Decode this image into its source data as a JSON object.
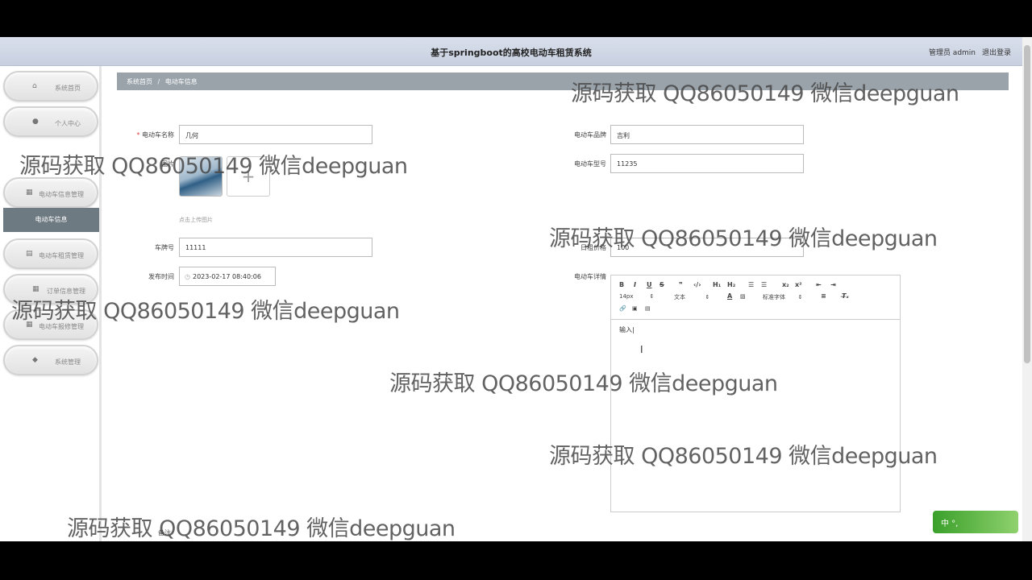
{
  "header": {
    "title": "基于springboot的高校电动车租赁系统",
    "user": "管理员 admin",
    "logout": "退出登录"
  },
  "sidebar": {
    "items": [
      {
        "label": "系统首页",
        "icon": "home-icon"
      },
      {
        "label": "个人中心",
        "icon": "user-icon"
      },
      {
        "label": "电动车信息管理",
        "icon": "grid-icon"
      },
      {
        "label": "电动车信息",
        "active": true
      },
      {
        "label": "电动车租赁管理",
        "icon": "doc-icon"
      },
      {
        "label": "订单信息管理",
        "icon": "grid-icon"
      },
      {
        "label": "电动车报修管理",
        "icon": "grid-icon"
      },
      {
        "label": "系统管理",
        "icon": "pin-icon"
      }
    ]
  },
  "breadcrumb": {
    "home": "系统首页",
    "sep": "/",
    "current": "电动车信息"
  },
  "form": {
    "name_label": "电动车名称",
    "name_value": "几何",
    "image_label": "图片",
    "upload_hint": "点击上传图片",
    "plate_label": "车牌号",
    "plate_value": "11111",
    "time_label": "发布时间",
    "time_value": "2023-02-17 08:40:06",
    "brand_label": "电动车品牌",
    "brand_value": "吉利",
    "model_label": "电动车型号",
    "model_value": "11235",
    "price_label": "日租价格",
    "price_value": "100",
    "detail_label": "电动车详情",
    "remark_label": "备注"
  },
  "editor": {
    "font_size": "14px",
    "block_type": "文本",
    "font_family": "标准字体",
    "body_text": "输入|"
  },
  "ime": {
    "label": "中 °,"
  },
  "watermark": "源码获取 QQ86050149 微信deepguan"
}
